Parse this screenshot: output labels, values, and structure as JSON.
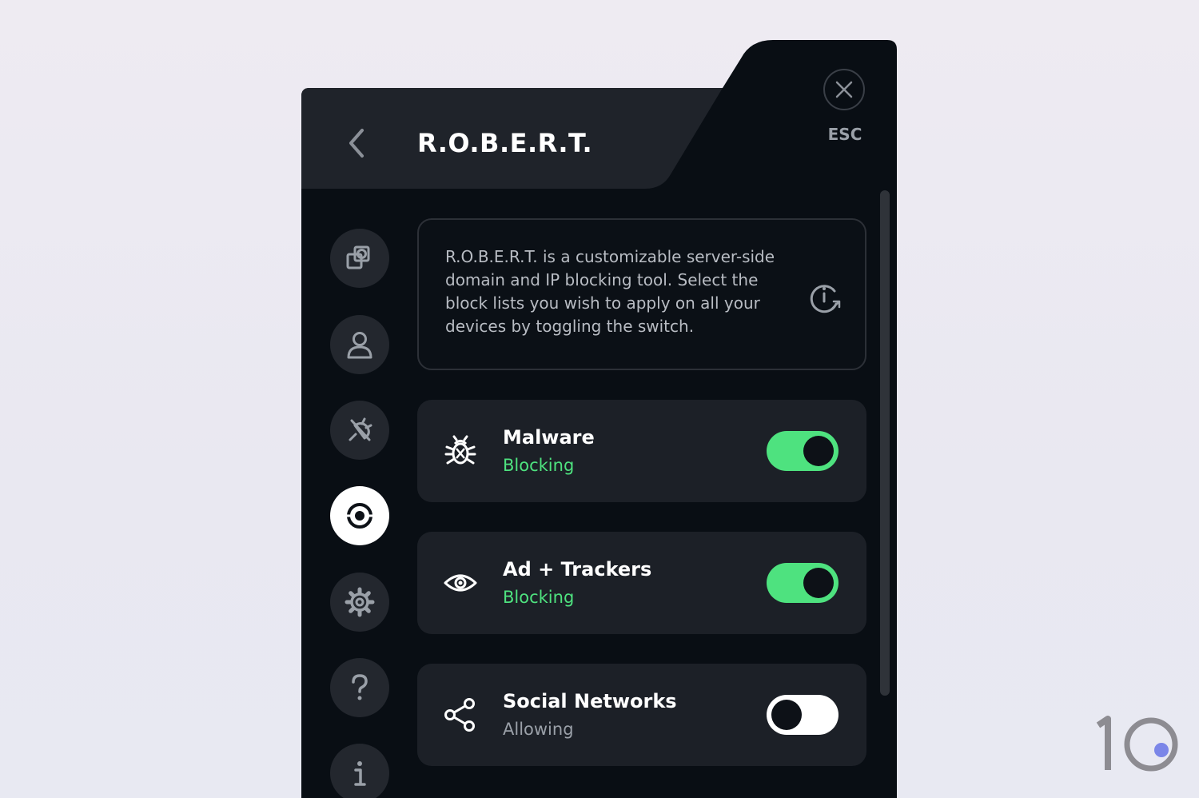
{
  "header": {
    "title": "R.O.B.E.R.T.",
    "esc_label": "ESC"
  },
  "nav": {
    "items": [
      {
        "icon": "layers-icon"
      },
      {
        "icon": "user-icon"
      },
      {
        "icon": "plug-icon"
      },
      {
        "icon": "robert-icon",
        "active": true
      },
      {
        "icon": "gear-icon"
      },
      {
        "icon": "question-icon"
      },
      {
        "icon": "info-icon"
      }
    ]
  },
  "info": {
    "text": "R.O.B.E.R.T. is a customizable server-side domain and IP blocking tool. Select the block lists you wish to apply on all your devices by toggling the switch."
  },
  "blocklists": [
    {
      "name": "Malware",
      "status": "Blocking",
      "enabled": true,
      "icon": "bug-icon"
    },
    {
      "name": "Ad + Trackers",
      "status": "Blocking",
      "enabled": true,
      "icon": "eye-icon"
    },
    {
      "name": "Social Networks",
      "status": "Allowing",
      "enabled": false,
      "icon": "share-icon"
    }
  ],
  "colors": {
    "panel_bg": "#090e14",
    "header_bg": "#1f232a",
    "accent_green": "#4ee27f",
    "allowing_gray": "#9aa0a8",
    "watermark_dot": "#7b86e8"
  },
  "watermark": {
    "text": "10"
  }
}
